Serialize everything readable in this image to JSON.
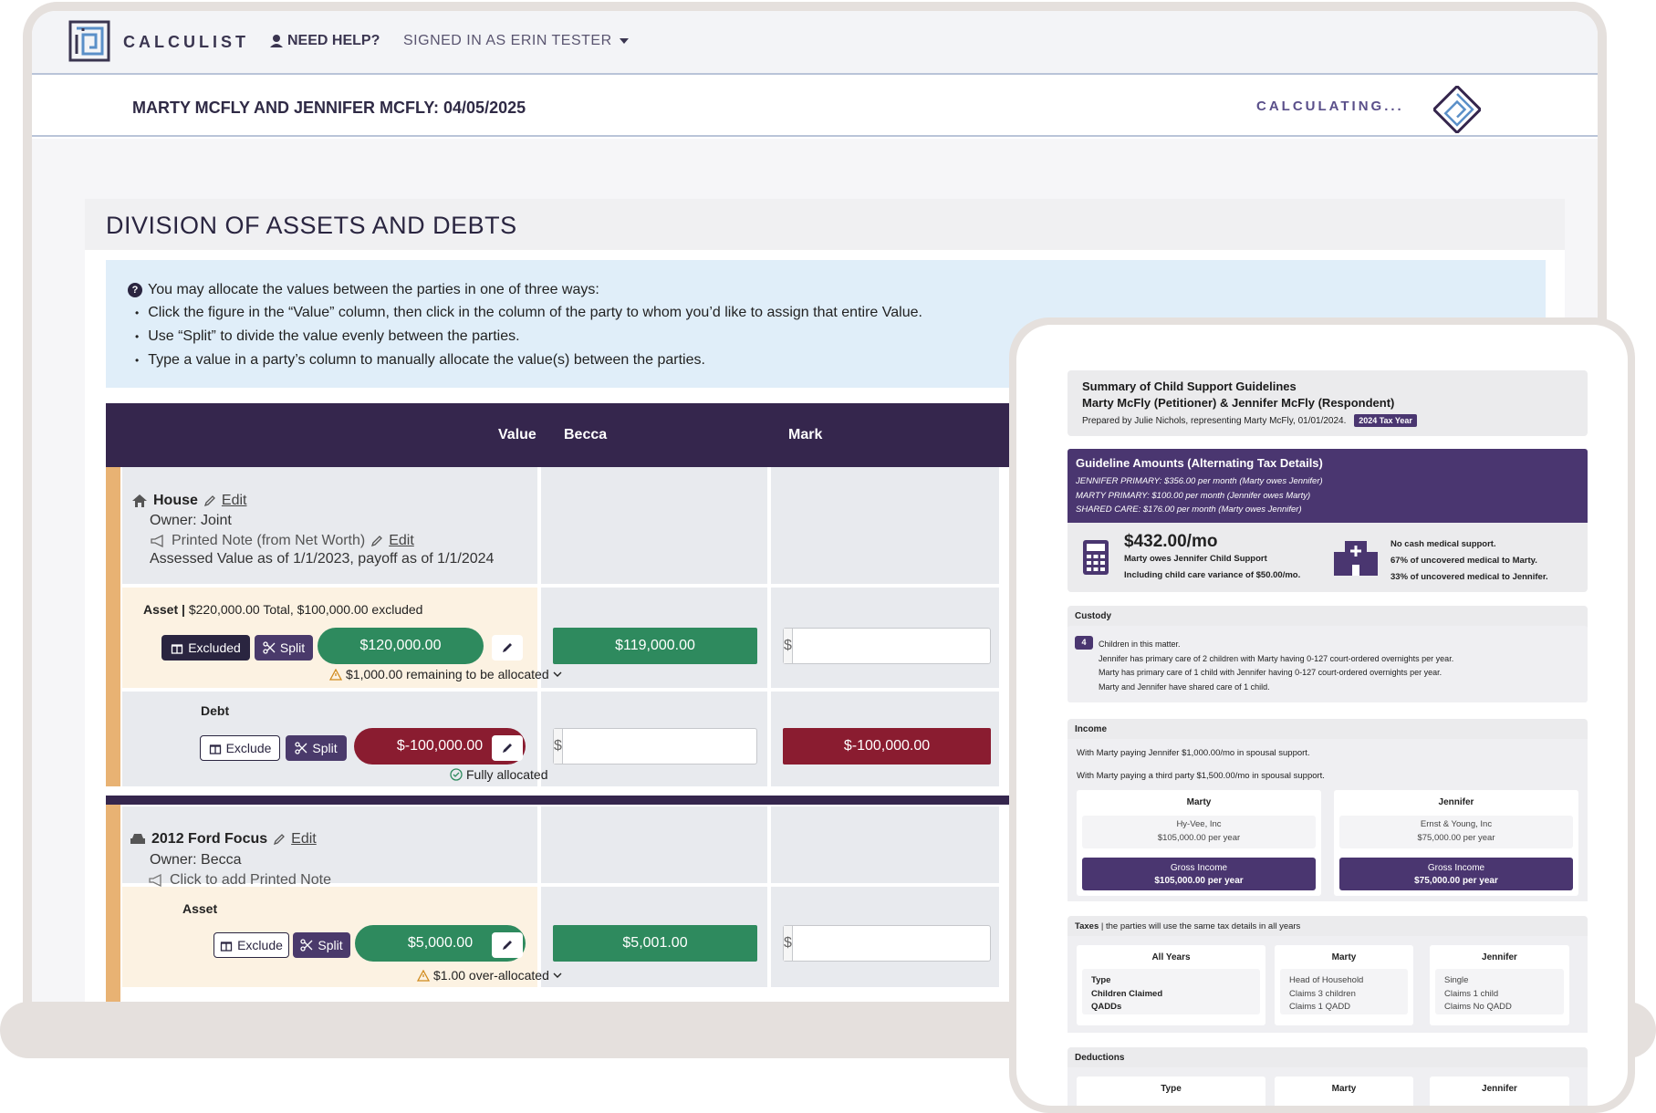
{
  "app": {
    "logo_text": "CALCULIST",
    "help_label": "NEED HELP?",
    "signed_in_label": "SIGNED IN AS ERIN TESTER"
  },
  "case": {
    "title": "MARTY MCFLY AND JENNIFER MCFLY: 04/05/2025",
    "status": "CALCULATING..."
  },
  "section": {
    "title": "DIVISION OF ASSETS AND DEBTS",
    "info_intro": "You may allocate the values between the parties in one of three ways:",
    "info_items": [
      "Click the figure in the “Value” column, then click in the column of the party to whom you’d like to assign that entire Value.",
      "Use “Split” to divide the value evenly between the parties.",
      "Type a value in a party’s column to manually allocate the value(s) between the parties."
    ]
  },
  "table": {
    "headers": {
      "value": "Value",
      "party1": "Becca",
      "party2": "Mark"
    },
    "currency_symbol": "$",
    "items": [
      {
        "name": "House",
        "edit_label": "Edit",
        "owner": "Owner: Joint",
        "printed_note": "Printed Note (from Net Worth)",
        "printed_note_edit": "Edit",
        "description": "Assessed Value as of 1/1/2023, payoff as of 1/1/2024",
        "asset": {
          "label": "Asset",
          "summary": "$220,000.00 Total, $100,000.00 excluded",
          "exclude_label": "Excluded",
          "split_label": "Split",
          "value": "$120,000.00",
          "party1_value": "$119,000.00",
          "status": "$1,000.00 remaining to be allocated"
        },
        "debt": {
          "label": "Debt",
          "exclude_label": "Exclude",
          "split_label": "Split",
          "value": "$-100,000.00",
          "party2_value": "$-100,000.00",
          "status": "Fully allocated"
        }
      },
      {
        "name": "2012 Ford Focus",
        "edit_label": "Edit",
        "owner": "Owner: Becca",
        "printed_note": "Click to add Printed Note",
        "asset": {
          "label": "Asset",
          "exclude_label": "Exclude",
          "split_label": "Split",
          "value": "$5,000.00",
          "party1_value": "$5,001.00",
          "status": "$1.00 over-allocated"
        }
      }
    ]
  },
  "summary": {
    "title": "Summary of Child Support Guidelines",
    "parties": "Marty McFly (Petitioner) & Jennifer McFly (Respondent)",
    "prepared": "Prepared by Julie Nichols, representing Marty McFly, 01/01/2024.",
    "tax_tag": "2024 Tax Year",
    "guideline_title": "Guideline Amounts (Alternating Tax Details)",
    "guideline_lines": [
      "JENNIFER PRIMARY: $356.00 per month (Marty owes Jennifer)",
      "MARTY PRIMARY: $100.00 per month (Jennifer owes Marty)",
      "SHARED CARE: $176.00 per month (Marty owes Jennifer)"
    ],
    "amount": "$432.00/mo",
    "amount_line1": "Marty owes Jennifer Child Support",
    "amount_line2": "Including child care variance of $50.00/mo.",
    "medical_line1": "No cash medical support.",
    "medical_line2": "67% of uncovered medical to Marty.",
    "medical_line3": "33% of uncovered medical to Jennifer.",
    "custody_title": "Custody",
    "children_count": "4",
    "custody_lines": [
      "Children in this matter.",
      "Jennifer has primary care of 2 children with Marty having 0-127 court-ordered overnights per year.",
      "Marty has primary care of 1 child with Jennifer having 0-127 court-ordered overnights per year.",
      "Marty and Jennifer have shared care of 1 child."
    ],
    "income_title": "Income",
    "income_lines": [
      "With Marty paying Jennifer $1,000.00/mo in spousal support.",
      "With Marty paying a third party $1,500.00/mo in spousal support."
    ],
    "income_parties": [
      {
        "name": "Marty",
        "employer": "Hy-Vee, Inc",
        "amount": "$105,000.00 per year",
        "gross_label": "Gross Income",
        "gross_value": "$105,000.00 per year"
      },
      {
        "name": "Jennifer",
        "employer": "Ernst & Young, Inc",
        "amount": "$75,000.00 per year",
        "gross_label": "Gross Income",
        "gross_value": "$75,000.00 per year"
      }
    ],
    "taxes_title": "Taxes",
    "taxes_note": "| the parties will use the same tax details in all years",
    "tax_cols": [
      {
        "head": "All Years",
        "lines": [
          "Type",
          "Children Claimed",
          "QADDs"
        ]
      },
      {
        "head": "Marty",
        "lines": [
          "Head of Household",
          "Claims 3 children",
          "Claims 1 QADD"
        ]
      },
      {
        "head": "Jennifer",
        "lines": [
          "Single",
          "Claims 1 child",
          "Claims No QADD"
        ]
      }
    ],
    "deductions_title": "Deductions",
    "deduction_cols": [
      "Type",
      "Marty",
      "Jennifer"
    ]
  }
}
